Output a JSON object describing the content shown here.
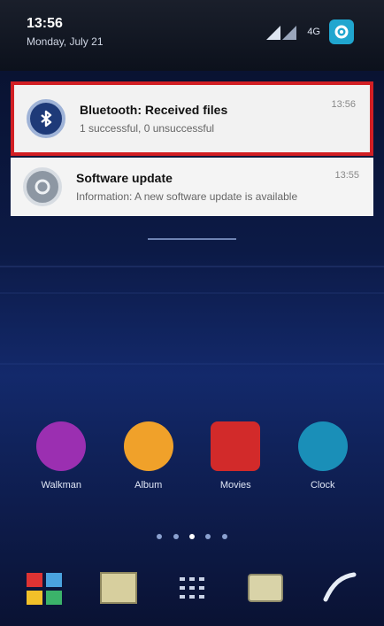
{
  "status_bar": {
    "time": "13:56",
    "date": "Monday, July 21",
    "signal_icon": "signal-icon",
    "battery_text": "4G",
    "settings_icon": "settings-icon"
  },
  "notifications": [
    {
      "title": "Bluetooth: Received files",
      "subtitle": "1 successful, 0 unsuccessful",
      "time": "13:56",
      "icon": "bluetooth-icon"
    },
    {
      "title": "Software update",
      "subtitle": "Information: A new software update is available",
      "time": "13:55",
      "icon": "software-update-icon"
    }
  ],
  "apps": [
    {
      "label": "Walkman",
      "color": "#9b2fb1"
    },
    {
      "label": "Album",
      "color": "#f0a12a"
    },
    {
      "label": "Movies",
      "color": "#d22a2a"
    },
    {
      "label": "Clock",
      "color": "#1a8fb8"
    }
  ],
  "dock": [
    {
      "icon": "apps-icon"
    },
    {
      "icon": "folder-icon"
    },
    {
      "icon": "app-drawer-icon"
    },
    {
      "icon": "messages-icon"
    },
    {
      "icon": "phone-icon"
    }
  ]
}
